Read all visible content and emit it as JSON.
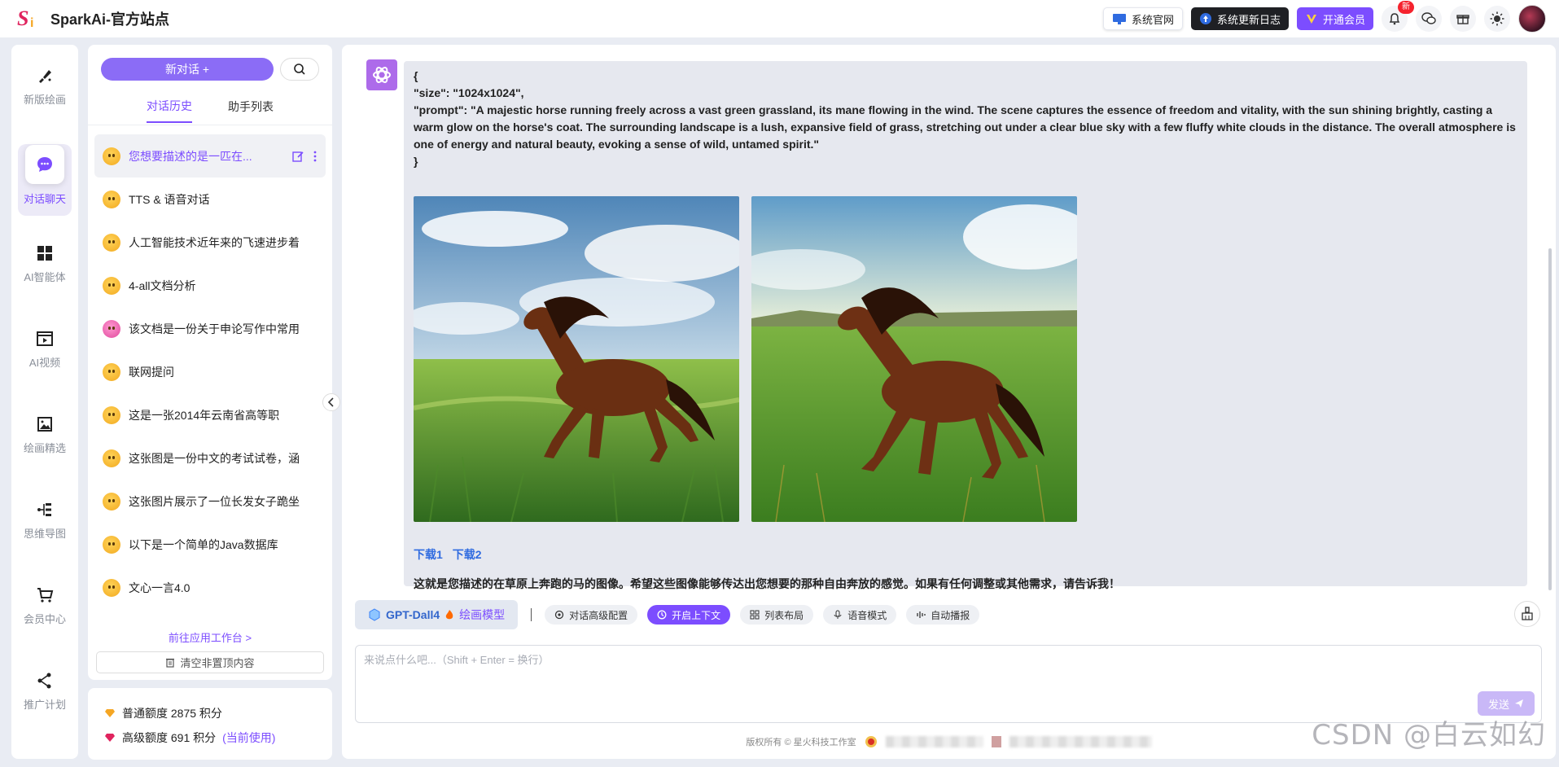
{
  "app": {
    "title": "SparkAi-官方站点"
  },
  "header": {
    "site_label": "系统官网",
    "changelog_label": "系统更新日志",
    "vip_label": "开通会员",
    "notify_badge": "新"
  },
  "nav": {
    "items": [
      {
        "label": "新版绘画",
        "icon": "brush-icon"
      },
      {
        "label": "对话聊天",
        "icon": "chat-icon"
      },
      {
        "label": "AI智能体",
        "icon": "grid-icon"
      },
      {
        "label": "AI视频",
        "icon": "video-icon"
      },
      {
        "label": "绘画精选",
        "icon": "image-icon"
      },
      {
        "label": "思维导图",
        "icon": "mindmap-icon"
      },
      {
        "label": "会员中心",
        "icon": "cart-icon"
      },
      {
        "label": "推广计划",
        "icon": "share-icon"
      }
    ]
  },
  "sidebar": {
    "new_chat": "新对话 +",
    "tabs": [
      "对话历史",
      "助手列表"
    ],
    "history": [
      "您想要描述的是一匹在...",
      "TTS & 语音对话",
      "人工智能技术近年来的飞速进步着",
      "4-all文档分析",
      "该文档是一份关于申论写作中常用",
      "联网提问",
      "这是一张2014年云南省高等职",
      "这张图是一份中文的考试试卷，涵",
      "这张图片展示了一位长发女子跪坐",
      "以下是一个简单的Java数据库",
      "文心一言4.0"
    ],
    "goto": "前往应用工作台 >",
    "clear": "清空非置顶内容"
  },
  "quota": {
    "normal": "普通额度 2875 积分",
    "advanced": "高级额度 691 积分",
    "current": "(当前使用)"
  },
  "message": {
    "json_lines": [
      "{",
      "\"size\": \"1024x1024\",",
      "\"prompt\": \"A majestic horse running freely across a vast green grassland, its mane flowing in the wind. The scene captures the essence of freedom and vitality, with the sun shining brightly, casting a warm glow on the horse's coat. The surrounding landscape is a lush, expansive field of grass, stretching out under a clear blue sky with a few fluffy white clouds in the distance. The overall atmosphere is one of energy and natural beauty, evoking a sense of wild, untamed spirit.\"",
      "}"
    ],
    "download1": "下载1",
    "download2": "下载2",
    "reply": "这就是您描述的在草原上奔跑的马的图像。希望这些图像能够传达出您想要的那种自由奔放的感觉。如果有任何调整或其他需求，请告诉我！"
  },
  "toolbar": {
    "model": "GPT-Dall4",
    "model_mode": "绘画模型",
    "chips": [
      "对话高级配置",
      "开启上下文",
      "列表布局",
      "语音模式",
      "自动播报"
    ]
  },
  "input": {
    "placeholder": "来说点什么吧...（Shift + Enter = 换行）",
    "send": "发送"
  },
  "footer": {
    "copyright": "版权所有 © 星火科技工作室"
  },
  "watermark": "CSDN @白云如幻",
  "colors": {
    "accent": "#7c4dff",
    "link": "#2f6be0",
    "bot": "#ad6bea"
  }
}
